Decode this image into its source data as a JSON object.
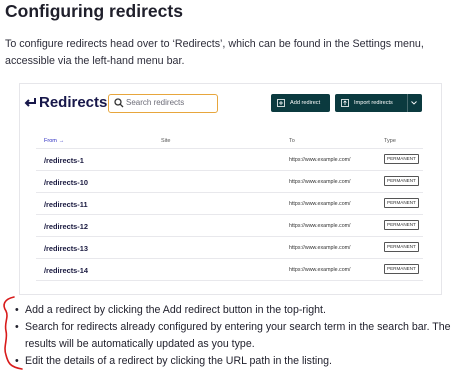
{
  "doc": {
    "title": "Configuring redirects",
    "intro": "To configure redirects head over to ‘Redirects’, which can be found in the Settings menu, accessible via the left-hand menu bar."
  },
  "screenshot": {
    "title": "Redirects",
    "search": {
      "placeholder": "Search redirects",
      "icon": "search-icon"
    },
    "buttons": {
      "add": {
        "label": "Add redirect",
        "icon": "plus-icon"
      },
      "import": {
        "label": "Import redirects",
        "icon": "upload-icon"
      }
    },
    "table": {
      "headers": {
        "from": "From",
        "site": "Site",
        "to": "To",
        "type": "Type"
      },
      "rows": [
        {
          "from": "/redirects-1",
          "to": "https://www.example.com/",
          "type": "PERMANENT"
        },
        {
          "from": "/redirects-10",
          "to": "https://www.example.com/",
          "type": "PERMANENT"
        },
        {
          "from": "/redirects-11",
          "to": "https://www.example.com/",
          "type": "PERMANENT"
        },
        {
          "from": "/redirects-12",
          "to": "https://www.example.com/",
          "type": "PERMANENT"
        },
        {
          "from": "/redirects-13",
          "to": "https://www.example.com/",
          "type": "PERMANENT"
        },
        {
          "from": "/redirects-14",
          "to": "https://www.example.com/",
          "type": "PERMANENT"
        }
      ]
    },
    "colors": {
      "accent": "#0b3a3f",
      "search_focus": "#e7a63d",
      "title": "#17174a",
      "annotation": "#d81b1b"
    }
  },
  "bullets": [
    "Add a redirect by clicking the Add redirect button in the top-right.",
    "Search for redirects already configured by entering your search term in the search bar. The results will be automatically updated as you type.",
    "Edit the details of a redirect by clicking the URL path in the listing."
  ]
}
